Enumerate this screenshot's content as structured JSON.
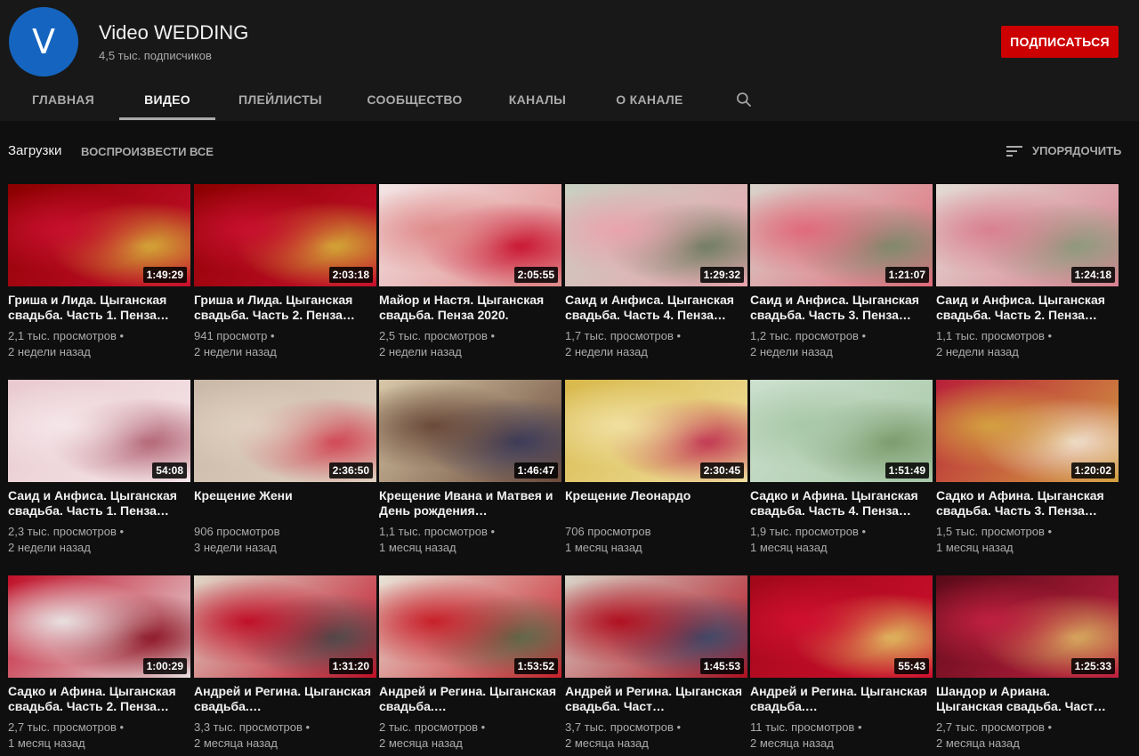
{
  "channel": {
    "avatar_letter": "V",
    "name": "Video WEDDING",
    "subscribers": "4,5 тыс. подписчиков",
    "subscribe_label": "ПОДПИСАТЬСЯ"
  },
  "tabs": [
    "ГЛАВНАЯ",
    "ВИДЕО",
    "ПЛЕЙЛИСТЫ",
    "СООБЩЕСТВО",
    "КАНАЛЫ",
    "О КАНАЛЕ"
  ],
  "active_tab": "ВИДЕО",
  "section": {
    "title": "Загрузки",
    "play_all": "ВОСПРОИЗВЕСТИ ВСЕ",
    "sort_label": "УПОРЯДОЧИТЬ"
  },
  "icons": {
    "search": "search-icon",
    "sort": "sort-icon"
  },
  "colors": {
    "background": "#0f0f0f",
    "header": "#181818",
    "subscribe": "#cc0000",
    "avatar": "#1565c0"
  },
  "videos": [
    {
      "title": "Гриша и Лида. Цыганская свадьба. Часть 1. Пенза…",
      "duration": "1:49:29",
      "views": "2,1 тыс. просмотров •",
      "age": "2 недели назад",
      "thumb": [
        "#8b0000",
        "#c8102e",
        "#d4af37"
      ]
    },
    {
      "title": "Гриша и Лида. Цыганская свадьба. Часть 2. Пенза…",
      "duration": "2:03:18",
      "views": "941 просмотр •",
      "age": "2 недели назад",
      "thumb": [
        "#8b0000",
        "#c8102e",
        "#d4af37"
      ]
    },
    {
      "title": "Майор и Настя. Цыганская свадьба. Пенза 2020.",
      "duration": "2:05:55",
      "views": "2,5 тыс. просмотров •",
      "age": "2 недели назад",
      "thumb": [
        "#f3e6e6",
        "#e08a8a",
        "#c8102e"
      ]
    },
    {
      "title": "Саид и Анфиса. Цыганская свадьба. Часть 4. Пенза…",
      "duration": "1:29:32",
      "views": "1,7 тыс. просмотров •",
      "age": "2 недели назад",
      "thumb": [
        "#c9d1c3",
        "#e9a3ad",
        "#6b7b5f"
      ]
    },
    {
      "title": "Саид и Анфиса. Цыганская свадьба. Часть 3. Пенза…",
      "duration": "1:21:07",
      "views": "1,2 тыс. просмотров •",
      "age": "2 недели назад",
      "thumb": [
        "#d9d4cc",
        "#e06a7a",
        "#7a8a6a"
      ]
    },
    {
      "title": "Саид и Анфиса. Цыганская свадьба. Часть 2. Пенза…",
      "duration": "1:24:18",
      "views": "1,1 тыс. просмотров •",
      "age": "2 недели назад",
      "thumb": [
        "#e3dcd5",
        "#d98090",
        "#8a9a7a"
      ]
    },
    {
      "title": "Саид и Анфиса. Цыганская свадьба. Часть 1. Пенза…",
      "duration": "54:08",
      "views": "2,3 тыс. просмотров •",
      "age": "2 недели назад",
      "thumb": [
        "#e8c9cf",
        "#f5e6e9",
        "#b06070"
      ]
    },
    {
      "title": "Крещение Жени",
      "duration": "2:36:50",
      "views": "906 просмотров",
      "age": "3 недели назад",
      "thumb": [
        "#c9b8a8",
        "#e0d0c0",
        "#d04050"
      ]
    },
    {
      "title": "Крещение Ивана и Матвея и День рождения…",
      "duration": "1:46:47",
      "views": "1,1 тыс. просмотров •",
      "age": "1 месяц назад",
      "thumb": [
        "#d8c8a8",
        "#6a4a3a",
        "#3a3a5a"
      ]
    },
    {
      "title": "Крещение Леонардо",
      "duration": "2:30:45",
      "views": "706 просмотров",
      "age": "1 месяц назад",
      "thumb": [
        "#d8b84a",
        "#f0e0a0",
        "#c03050"
      ]
    },
    {
      "title": "Садко и Афина. Цыганская свадьба. Часть 4. Пенза…",
      "duration": "1:51:49",
      "views": "1,9 тыс. просмотров •",
      "age": "1 месяц назад",
      "thumb": [
        "#cde0cf",
        "#a8c8a8",
        "#7a9a6a"
      ]
    },
    {
      "title": "Садко и Афина. Цыганская свадьба. Часть 3. Пенза…",
      "duration": "1:20:02",
      "views": "1,5 тыс. просмотров •",
      "age": "1 месяц назад",
      "thumb": [
        "#b8203a",
        "#d4a040",
        "#f0e0d0"
      ]
    },
    {
      "title": "Садко и Афина. Цыганская свадьба. Часть 2. Пенза…",
      "duration": "1:00:29",
      "views": "2,7 тыс. просмотров •",
      "age": "1 месяц назад",
      "thumb": [
        "#c01028",
        "#e8e0e0",
        "#8a1020"
      ]
    },
    {
      "title": "Андрей и Регина. Цыганская свадьба.…",
      "duration": "1:31:20",
      "views": "3,3 тыс. просмотров •",
      "age": "2 месяца назад",
      "thumb": [
        "#e0d8c8",
        "#c01028",
        "#4a4a4a"
      ]
    },
    {
      "title": "Андрей и Регина. Цыганская свадьба.…",
      "duration": "1:53:52",
      "views": "2 тыс. просмотров •",
      "age": "2 месяца назад",
      "thumb": [
        "#e8e4d8",
        "#c8202a",
        "#5a6a4a"
      ]
    },
    {
      "title": "Андрей и Регина. Цыганская свадьба. Част…",
      "duration": "1:45:53",
      "views": "3,7 тыс. просмотров •",
      "age": "2 месяца назад",
      "thumb": [
        "#d8d4c8",
        "#b01020",
        "#3a4a6a"
      ]
    },
    {
      "title": "Андрей и Регина. Цыганская свадьба.…",
      "duration": "55:43",
      "views": "11 тыс. просмотров •",
      "age": "2 месяца назад",
      "thumb": [
        "#a00818",
        "#d01030",
        "#e0c060"
      ]
    },
    {
      "title": "Шандор и Ариана. Цыганская свадьба. Част…",
      "duration": "1:25:33",
      "views": "2,7 тыс. просмотров •",
      "age": "2 месяца назад",
      "thumb": [
        "#5a0a18",
        "#c02040",
        "#d8b060"
      ]
    }
  ]
}
